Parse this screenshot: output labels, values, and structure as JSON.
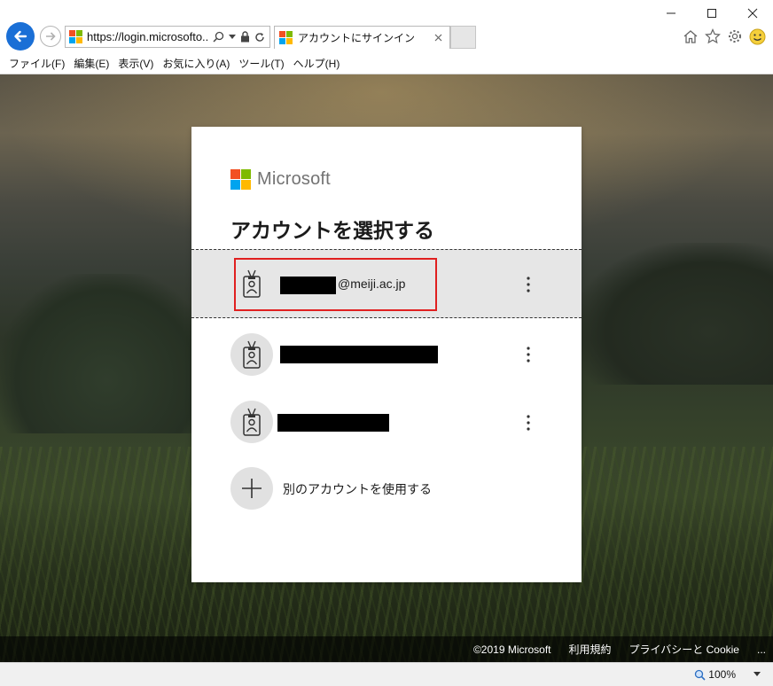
{
  "browser": {
    "url": "https://login.microsofto...",
    "tab_title": "アカウントにサインイン",
    "menu": [
      "ファイル(F)",
      "編集(E)",
      "表示(V)",
      "お気に入り(A)",
      "ツール(T)",
      "ヘルプ(H)"
    ],
    "zoom": "100%"
  },
  "card": {
    "brand": "Microsoft",
    "title": "アカウントを選択する",
    "accounts": [
      {
        "email_suffix": "@meiji.ac.jp",
        "selected": true
      },
      {
        "email_suffix": "",
        "selected": false
      },
      {
        "email_suffix": "",
        "selected": false
      }
    ],
    "other_account_label": "別のアカウントを使用する"
  },
  "footer": {
    "copyright": "©2019 Microsoft",
    "terms": "利用規約",
    "privacy": "プライバシーと Cookie",
    "more": "..."
  },
  "colors": {
    "ms_red": "#f25022",
    "ms_green": "#7fba00",
    "ms_blue": "#00a4ef",
    "ms_yellow": "#ffb900",
    "back_button": "#1a6fd6",
    "highlight_box": "#e02020"
  }
}
